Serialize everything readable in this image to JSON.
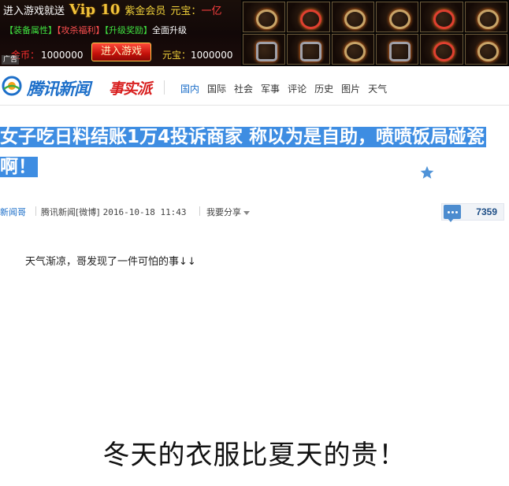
{
  "ad": {
    "row1_prefix": "进入游戏就送",
    "vip": "Vip 10",
    "member": "紫金会员",
    "yuanbao_label": "元宝：",
    "yuanbao_value": "一亿",
    "attr1": "【装备属性】",
    "attr2": "【攻杀福利】",
    "attr3": "【升级奖励】",
    "attr4": "全面升级",
    "gold_label": "金币：",
    "gold_value": "1000000",
    "enter_button": "进入游戏",
    "yb2_label": "元宝：",
    "yb2_value": "1000000",
    "tag": "广告",
    "colors": {
      "gold": "#f2c33a",
      "red": "#ff3030",
      "green": "#40e040"
    }
  },
  "header": {
    "logo_text": "腾讯新闻",
    "brand_tag": "事实派",
    "nav": [
      "国内",
      "国际",
      "社会",
      "军事",
      "评论",
      "历史",
      "图片",
      "天气"
    ],
    "active_nav": "国内",
    "accent_color": "#1d6fc9"
  },
  "article": {
    "title": "女子吃日料结账1万4投诉商家 称以为是自助，喷喷饭局碰瓷啊！",
    "author": "新闻哥",
    "source": "腾讯新闻[微博]",
    "time": "2016-10-18 11:43",
    "share": "我要分享",
    "comment_count": "7359",
    "paragraph": "天气渐凉，哥发现了一件可怕的事↓↓",
    "image_caption": "冬天的衣服比夏天的贵！",
    "highlight_color": "#3e8de2"
  }
}
